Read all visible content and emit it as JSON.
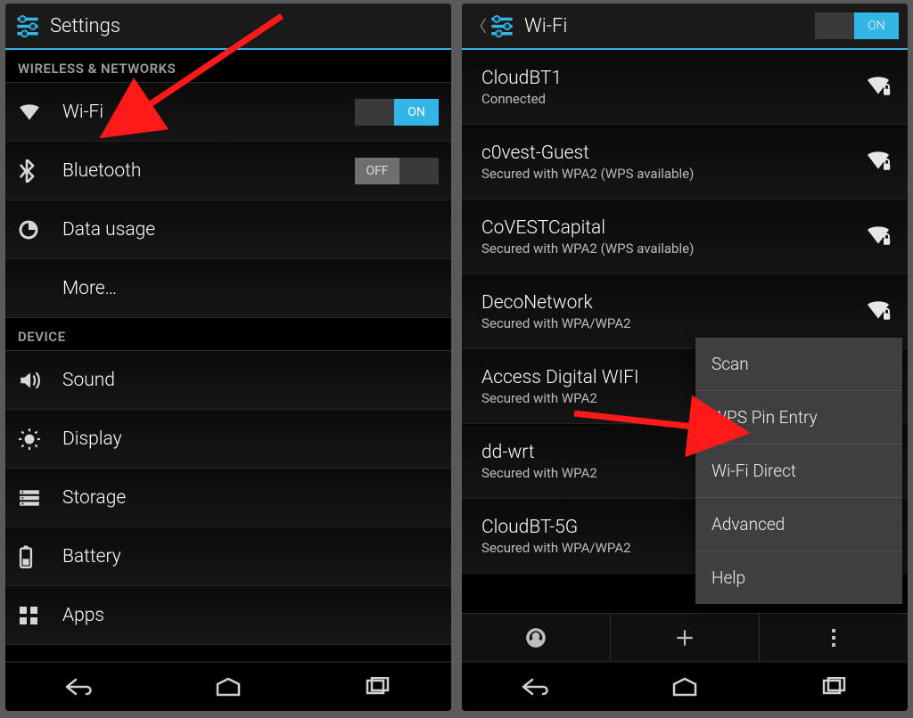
{
  "left": {
    "title": "Settings",
    "sections": {
      "wireless": {
        "header": "WIRELESS & NETWORKS",
        "wifi": {
          "label": "Wi-Fi",
          "toggle": "ON"
        },
        "bluetooth": {
          "label": "Bluetooth",
          "toggle": "OFF"
        },
        "data_usage": {
          "label": "Data usage"
        },
        "more": {
          "label": "More…"
        }
      },
      "device": {
        "header": "DEVICE",
        "sound": {
          "label": "Sound"
        },
        "display": {
          "label": "Display"
        },
        "storage": {
          "label": "Storage"
        },
        "battery": {
          "label": "Battery"
        },
        "apps": {
          "label": "Apps"
        }
      }
    }
  },
  "right": {
    "title": "Wi-Fi",
    "toggle": "ON",
    "networks": [
      {
        "ssid": "CloudBT1",
        "status": "Connected",
        "locked": true
      },
      {
        "ssid": "c0vest-Guest",
        "status": "Secured with WPA2 (WPS available)",
        "locked": true
      },
      {
        "ssid": "CoVESTCapital",
        "status": "Secured with WPA2 (WPS available)",
        "locked": true
      },
      {
        "ssid": "DecoNetwork",
        "status": "Secured with WPA/WPA2",
        "locked": true
      },
      {
        "ssid": "Access Digital WIFI",
        "status": "Secured with WPA2",
        "locked": true
      },
      {
        "ssid": "dd-wrt",
        "status": "Secured with WPA2",
        "locked": true
      },
      {
        "ssid": "CloudBT-5G",
        "status": "Secured with WPA/WPA2",
        "locked": true
      }
    ],
    "menu": [
      "Scan",
      "WPS Pin Entry",
      "Wi-Fi Direct",
      "Advanced",
      "Help"
    ]
  }
}
